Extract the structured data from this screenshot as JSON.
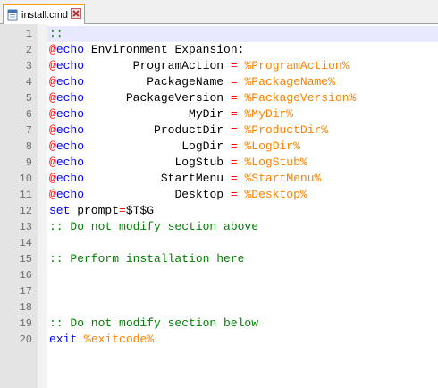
{
  "tab": {
    "label": "install.cmd",
    "icon": "file-icon",
    "close_icon": "close-icon",
    "accent": "#f5a21b"
  },
  "colors": {
    "comment": "#008000",
    "echo_at": "#ff0000",
    "keyword": "#0000ff",
    "operator": "#ff0000",
    "variable": "#ff8000",
    "current_line": "#e8e8ff"
  },
  "lines": [
    {
      "n": "1",
      "tokens": [
        {
          "t": "::",
          "c": "comment"
        }
      ]
    },
    {
      "n": "2",
      "tokens": [
        {
          "t": "@",
          "c": "at"
        },
        {
          "t": "echo",
          "c": "kw"
        },
        {
          "t": " Environment Expansion:",
          "c": "text"
        }
      ]
    },
    {
      "n": "3",
      "tokens": [
        {
          "t": "@",
          "c": "at"
        },
        {
          "t": "echo",
          "c": "kw"
        },
        {
          "t": "       ProgramAction ",
          "c": "text"
        },
        {
          "t": "=",
          "c": "op"
        },
        {
          "t": " ",
          "c": "text"
        },
        {
          "t": "%ProgramAction%",
          "c": "var"
        }
      ]
    },
    {
      "n": "4",
      "tokens": [
        {
          "t": "@",
          "c": "at"
        },
        {
          "t": "echo",
          "c": "kw"
        },
        {
          "t": "         PackageName ",
          "c": "text"
        },
        {
          "t": "=",
          "c": "op"
        },
        {
          "t": " ",
          "c": "text"
        },
        {
          "t": "%PackageName%",
          "c": "var"
        }
      ]
    },
    {
      "n": "5",
      "tokens": [
        {
          "t": "@",
          "c": "at"
        },
        {
          "t": "echo",
          "c": "kw"
        },
        {
          "t": "      PackageVersion ",
          "c": "text"
        },
        {
          "t": "=",
          "c": "op"
        },
        {
          "t": " ",
          "c": "text"
        },
        {
          "t": "%PackageVersion%",
          "c": "var"
        }
      ]
    },
    {
      "n": "6",
      "tokens": [
        {
          "t": "@",
          "c": "at"
        },
        {
          "t": "echo",
          "c": "kw"
        },
        {
          "t": "               MyDir ",
          "c": "text"
        },
        {
          "t": "=",
          "c": "op"
        },
        {
          "t": " ",
          "c": "text"
        },
        {
          "t": "%MyDir%",
          "c": "var"
        }
      ]
    },
    {
      "n": "7",
      "tokens": [
        {
          "t": "@",
          "c": "at"
        },
        {
          "t": "echo",
          "c": "kw"
        },
        {
          "t": "          ProductDir ",
          "c": "text"
        },
        {
          "t": "=",
          "c": "op"
        },
        {
          "t": " ",
          "c": "text"
        },
        {
          "t": "%ProductDir%",
          "c": "var"
        }
      ]
    },
    {
      "n": "8",
      "tokens": [
        {
          "t": "@",
          "c": "at"
        },
        {
          "t": "echo",
          "c": "kw"
        },
        {
          "t": "              LogDir ",
          "c": "text"
        },
        {
          "t": "=",
          "c": "op"
        },
        {
          "t": " ",
          "c": "text"
        },
        {
          "t": "%LogDir%",
          "c": "var"
        }
      ]
    },
    {
      "n": "9",
      "tokens": [
        {
          "t": "@",
          "c": "at"
        },
        {
          "t": "echo",
          "c": "kw"
        },
        {
          "t": "             LogStub ",
          "c": "text"
        },
        {
          "t": "=",
          "c": "op"
        },
        {
          "t": " ",
          "c": "text"
        },
        {
          "t": "%LogStub%",
          "c": "var"
        }
      ]
    },
    {
      "n": "10",
      "tokens": [
        {
          "t": "@",
          "c": "at"
        },
        {
          "t": "echo",
          "c": "kw"
        },
        {
          "t": "           StartMenu ",
          "c": "text"
        },
        {
          "t": "=",
          "c": "op"
        },
        {
          "t": " ",
          "c": "text"
        },
        {
          "t": "%StartMenu%",
          "c": "var"
        }
      ]
    },
    {
      "n": "11",
      "tokens": [
        {
          "t": "@",
          "c": "at"
        },
        {
          "t": "echo",
          "c": "kw"
        },
        {
          "t": "             Desktop ",
          "c": "text"
        },
        {
          "t": "=",
          "c": "op"
        },
        {
          "t": " ",
          "c": "text"
        },
        {
          "t": "%Desktop%",
          "c": "var"
        }
      ]
    },
    {
      "n": "12",
      "tokens": [
        {
          "t": "set",
          "c": "kw"
        },
        {
          "t": " prompt",
          "c": "text"
        },
        {
          "t": "=",
          "c": "op"
        },
        {
          "t": "$T$G",
          "c": "text"
        }
      ]
    },
    {
      "n": "13",
      "tokens": [
        {
          "t": ":: Do not modify section above",
          "c": "comment"
        }
      ]
    },
    {
      "n": "14",
      "tokens": []
    },
    {
      "n": "15",
      "tokens": [
        {
          "t": ":: Perform installation here",
          "c": "comment"
        }
      ]
    },
    {
      "n": "16",
      "tokens": []
    },
    {
      "n": "17",
      "tokens": []
    },
    {
      "n": "18",
      "tokens": []
    },
    {
      "n": "19",
      "tokens": [
        {
          "t": ":: Do not modify section below",
          "c": "comment"
        }
      ]
    },
    {
      "n": "20",
      "tokens": [
        {
          "t": "exit",
          "c": "kw"
        },
        {
          "t": " ",
          "c": "text"
        },
        {
          "t": "%exitcode%",
          "c": "var"
        }
      ]
    }
  ]
}
